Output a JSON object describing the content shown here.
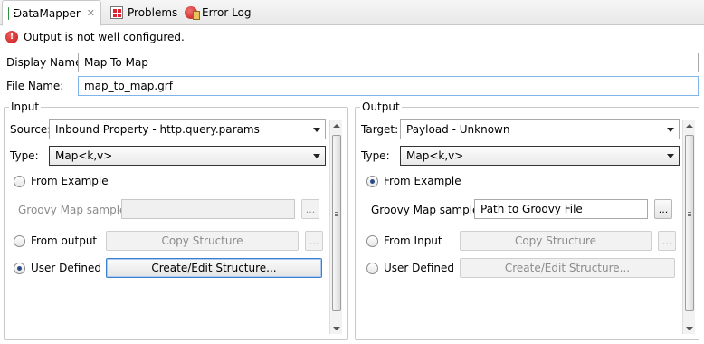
{
  "tabs": [
    {
      "label": "DataMapper",
      "icon": "datamapper-icon",
      "active": true
    },
    {
      "label": "Problems",
      "icon": "problems-icon"
    },
    {
      "label": "Error Log",
      "icon": "error-log-icon"
    }
  ],
  "error_message": "Output is not well configured.",
  "display_name": {
    "label": "Display Name:",
    "value": "Map To Map"
  },
  "file_name": {
    "label": "File Name:",
    "value": "map_to_map.grf"
  },
  "input": {
    "title": "Input",
    "source_label": "Source:",
    "source_value": "Inbound Property - http.query.params",
    "type_label": "Type:",
    "type_value": "Map<k,v>",
    "from_example": "From Example",
    "groovy_label": "Groovy Map sample:",
    "groovy_value": "",
    "browse": "...",
    "from_output": "From output",
    "copy_structure": "Copy Structure",
    "user_defined": "User Defined",
    "create_edit": "Create/Edit Structure..."
  },
  "output": {
    "title": "Output",
    "target_label": "Target:",
    "target_value": "Payload - Unknown",
    "type_label": "Type:",
    "type_value": "Map<k,v>",
    "from_example": "From Example",
    "groovy_label": "Groovy Map sample:",
    "groovy_value": "Path to Groovy File",
    "browse": "...",
    "from_input": "From Input",
    "copy_structure": "Copy Structure",
    "user_defined": "User Defined",
    "create_edit": "Create/Edit Structure..."
  }
}
